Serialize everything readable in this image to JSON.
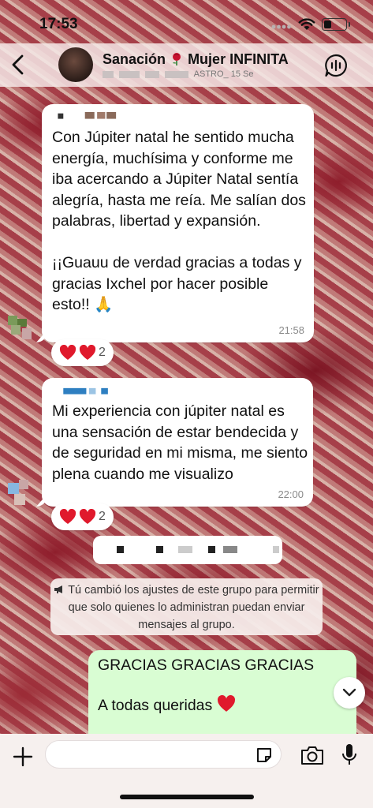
{
  "status_bar": {
    "time": "17:53"
  },
  "header": {
    "group_name_prefix": "Sanación",
    "group_name_suffix": "Mujer INFINITA",
    "subtitle_visible": "ASTRO_ 15 Se"
  },
  "messages": [
    {
      "text": "Con Júpiter natal he sentido mucha energía, muchísima y conforme me iba acercando a Júpiter Natal sentía alegría, hasta me reía. Me salían dos palabras, libertad y expansión.\n\n¡¡Guauu de verdad gracias a todas y gracias Ixchel por hacer posible esto!! 🙏",
      "time": "21:58",
      "reaction_count": "2"
    },
    {
      "text": "Mi experiencia con júpiter natal es una sensación de estar bendecida y de seguridad en mi misma, me siento plena cuando me visualizo",
      "time": "22:00",
      "reaction_count": "2"
    }
  ],
  "system_note": "Tú cambió los ajustes de este grupo para permitir que solo quienes lo administran puedan enviar mensajes al grupo.",
  "outgoing": {
    "line1": "GRACIAS GRACIAS GRACIAS",
    "line2": "A todas queridas"
  },
  "colors": {
    "outgoing_bubble": "#d9fdd3",
    "heart": "#e0192c",
    "rose": "#c8102e"
  }
}
